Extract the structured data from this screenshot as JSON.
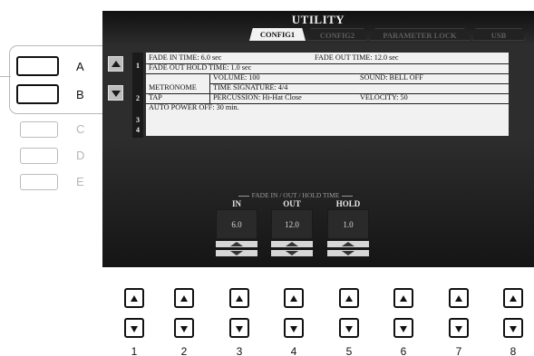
{
  "side_buttons": [
    {
      "label": "A",
      "active": true
    },
    {
      "label": "B",
      "active": true
    },
    {
      "label": "C",
      "active": false
    },
    {
      "label": "D",
      "active": false
    },
    {
      "label": "E",
      "active": false
    }
  ],
  "screen": {
    "title": "UTILITY",
    "tabs": [
      "CONFIG1",
      "CONFIG2",
      "PARAMETER LOCK",
      "USB"
    ],
    "active_tab": "CONFIG1",
    "row_numbers": [
      "1",
      "2",
      "3",
      "4"
    ],
    "rows": {
      "fade_in": "FADE IN TIME:  6.0 sec",
      "fade_out": "FADE OUT TIME: 12.0 sec",
      "fade_out_hold": "FADE OUT HOLD TIME: 1.0 sec",
      "metronome": "METRONOME",
      "volume": "VOLUME: 100",
      "sound": "SOUND: BELL OFF",
      "time_signature": "TIME SIGNATURE:    4/4",
      "tap": "TAP",
      "percussion": "PERCUSSION: Hi-Hat Close",
      "velocity": "VELOCITY: 50",
      "auto_power_off": "AUTO POWER OFF:  30 min."
    },
    "fade_group": {
      "title": "FADE IN / OUT / HOLD TIME",
      "columns": [
        {
          "header": "IN",
          "value": "6.0"
        },
        {
          "header": "OUT",
          "value": "12.0"
        },
        {
          "header": "HOLD",
          "value": "1.0"
        }
      ]
    }
  },
  "bottom_buttons": [
    "1",
    "2",
    "3",
    "4",
    "5",
    "6",
    "7",
    "8"
  ],
  "icons": {
    "up": "up-arrow-icon",
    "down": "down-arrow-icon"
  }
}
